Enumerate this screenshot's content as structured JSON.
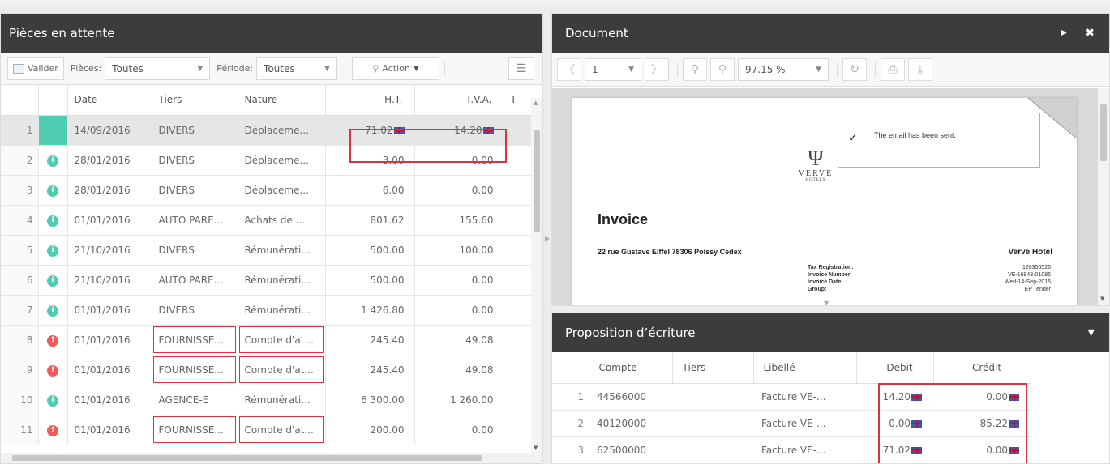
{
  "left_panel": {
    "title": "Pièces en attente",
    "toolbar": {
      "validate_label": "Valider",
      "pieces_label": "Pièces:",
      "pieces_value": "Toutes",
      "periode_label": "Période:",
      "periode_value": "Toutes",
      "action_label": "Action"
    },
    "columns": [
      "",
      "",
      "Date",
      "Tiers",
      "Nature",
      "H.T.",
      "T.V.A.",
      "T"
    ],
    "rows": [
      {
        "n": "1",
        "status": "none",
        "date": "14/09/2016",
        "tiers": "DIVERS",
        "nature": "Déplaceme...",
        "ht": "71.02",
        "tva": "14.20",
        "flags": true,
        "highlight_amounts": true,
        "selected": true
      },
      {
        "n": "2",
        "status": "green",
        "date": "28/01/2016",
        "tiers": "DIVERS",
        "nature": "Déplaceme...",
        "ht": "3.00",
        "tva": "0.00"
      },
      {
        "n": "3",
        "status": "green",
        "date": "28/01/2016",
        "tiers": "DIVERS",
        "nature": "Déplaceme...",
        "ht": "6.00",
        "tva": "0.00"
      },
      {
        "n": "4",
        "status": "green",
        "date": "01/01/2016",
        "tiers": "AUTO PARE...",
        "nature": "Achats de ...",
        "ht": "801.62",
        "tva": "155.60"
      },
      {
        "n": "5",
        "status": "green",
        "date": "21/10/2016",
        "tiers": "DIVERS",
        "nature": "Rémunérati...",
        "ht": "500.00",
        "tva": "100.00"
      },
      {
        "n": "6",
        "status": "green",
        "date": "21/10/2016",
        "tiers": "AUTO PARE...",
        "nature": "Rémunérati...",
        "ht": "500.00",
        "tva": "0.00"
      },
      {
        "n": "7",
        "status": "green",
        "date": "01/01/2016",
        "tiers": "DIVERS",
        "nature": "Rémunérati...",
        "ht": "1 426.80",
        "tva": "0.00"
      },
      {
        "n": "8",
        "status": "red",
        "date": "01/01/2016",
        "tiers": "FOURNISSE...",
        "nature": "Compte d'at...",
        "ht": "245.40",
        "tva": "49.08",
        "boxed": true
      },
      {
        "n": "9",
        "status": "red",
        "date": "01/01/2016",
        "tiers": "FOURNISSE...",
        "nature": "Compte d'at...",
        "ht": "245.40",
        "tva": "49.08",
        "boxed": true
      },
      {
        "n": "10",
        "status": "green",
        "date": "01/01/2016",
        "tiers": "AGENCE-E",
        "nature": "Rémunérati...",
        "ht": "6 300.00",
        "tva": "1 260.00"
      },
      {
        "n": "11",
        "status": "red",
        "date": "01/01/2016",
        "tiers": "FOURNISSE...",
        "nature": "Compte d'at...",
        "ht": "200.00",
        "tva": "0.00",
        "boxed": true
      }
    ]
  },
  "document_panel": {
    "title": "Document",
    "page_value": "1",
    "zoom_value": "97.15 %",
    "invoice": {
      "toast": "The email has been sent.",
      "brand": "VERVE",
      "brand_sub": "HOTELS",
      "heading": "Invoice",
      "address": "22 rue Gustave Eiffel 78306 Poissy Cedex",
      "company": "Verve Hotel",
      "fields": [
        {
          "label": "Tax Registration:",
          "value": "128306526"
        },
        {
          "label": "Invoice Number:",
          "value": "VE-16943-01086"
        },
        {
          "label": "Invoice Date:",
          "value": "Wed-14-Sep-2016"
        },
        {
          "label": "Group:",
          "value": "EP Tender"
        }
      ]
    }
  },
  "proposal_panel": {
    "title": "Proposition d’écriture",
    "columns": [
      "",
      "Compte",
      "Tiers",
      "Libellé",
      "Débit",
      "Crédit"
    ],
    "rows": [
      {
        "n": "1",
        "compte": "44566000",
        "tiers": "",
        "libelle": "Facture VE-...",
        "debit": "14.20",
        "credit": "0.00"
      },
      {
        "n": "2",
        "compte": "40120000",
        "tiers": "",
        "libelle": "Facture VE-...",
        "debit": "0.00",
        "credit": "85.22"
      },
      {
        "n": "3",
        "compte": "62500000",
        "tiers": "",
        "libelle": "Facture VE-...",
        "debit": "71.02",
        "credit": "0.00"
      }
    ]
  },
  "colors": {
    "header_bg": "#3c3c3c",
    "status_green": "#4ecdb3",
    "status_red": "#ef5a5a",
    "highlight_red": "#d9333f"
  }
}
